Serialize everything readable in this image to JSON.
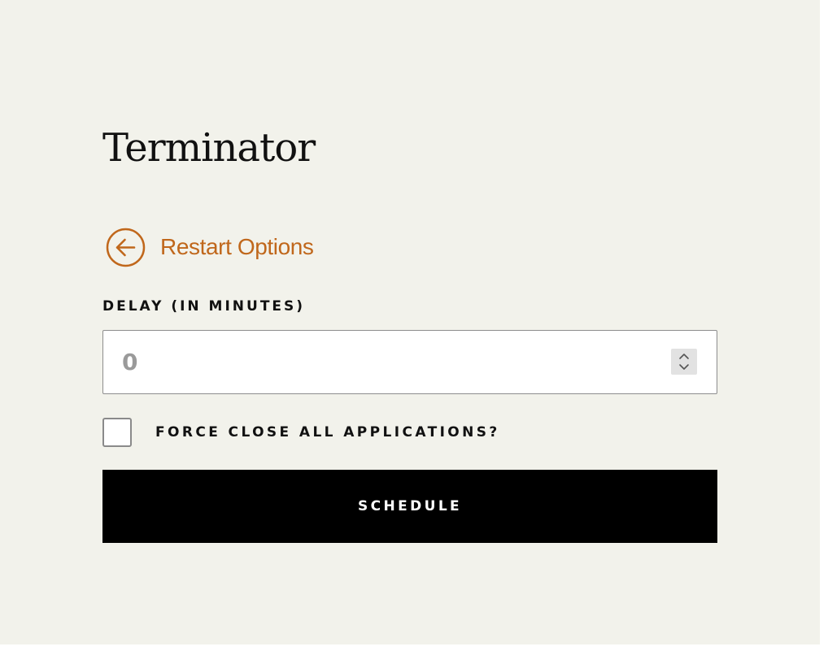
{
  "app": {
    "title": "Terminator"
  },
  "back_link": {
    "label": "Restart Options",
    "icon": "arrow-left-circle-icon"
  },
  "delay_field": {
    "label": "DELAY (IN MINUTES)",
    "value": "0"
  },
  "force_close": {
    "label": "FORCE CLOSE ALL APPLICATIONS?",
    "checked": false
  },
  "schedule_button": {
    "label": "SCHEDULE"
  },
  "colors": {
    "background": "#f2f2eb",
    "accent": "#c0671b",
    "button": "#000000",
    "text": "#111111"
  }
}
